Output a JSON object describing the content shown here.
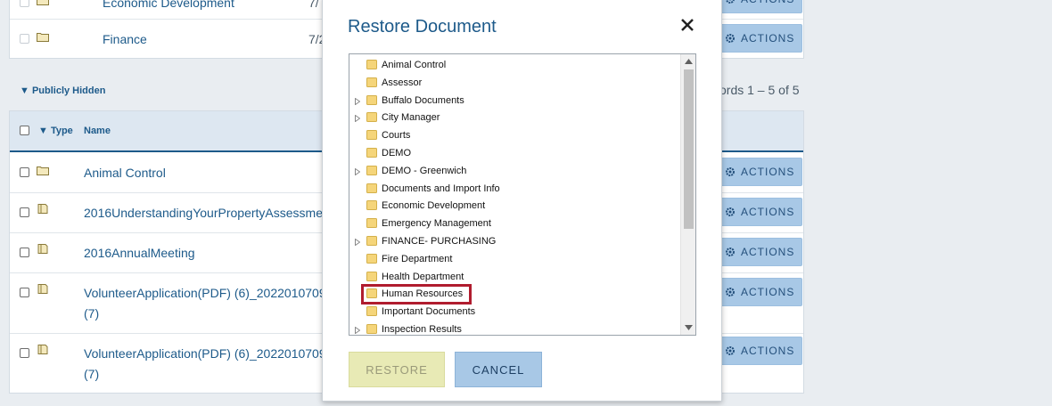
{
  "top_list": {
    "rows": [
      {
        "name": "Economic Development",
        "date": "7/"
      },
      {
        "name": "Finance",
        "date": "7/2"
      }
    ],
    "actions_label": "ACTIONS"
  },
  "hidden_section": {
    "title": "▼ Publicly Hidden",
    "records": "ords 1 – 5 of 5",
    "header": {
      "type": "▼ Type",
      "name": "Name"
    },
    "rows": [
      {
        "name": "Animal Control",
        "kind": "folder"
      },
      {
        "name": "2016UnderstandingYourPropertyAssessme",
        "kind": "doc"
      },
      {
        "name": "2016AnnualMeeting",
        "kind": "doc"
      },
      {
        "name": "VolunteerApplication(PDF) (6)_2022010709",
        "line2": "(7)",
        "kind": "doc"
      },
      {
        "name": "VolunteerApplication(PDF) (6)_2022010709",
        "line2": "(7)",
        "kind": "doc"
      }
    ],
    "actions_label": "ACTIONS"
  },
  "dialog": {
    "title": "Restore Document",
    "tree": [
      {
        "label": "Animal Control",
        "expandable": false
      },
      {
        "label": "Assessor",
        "expandable": false
      },
      {
        "label": "Buffalo Documents",
        "expandable": true
      },
      {
        "label": "City Manager",
        "expandable": true
      },
      {
        "label": "Courts",
        "expandable": false
      },
      {
        "label": "DEMO",
        "expandable": false
      },
      {
        "label": "DEMO - Greenwich",
        "expandable": true
      },
      {
        "label": "Documents and Import Info",
        "expandable": false
      },
      {
        "label": "Economic Development",
        "expandable": false
      },
      {
        "label": "Emergency Management",
        "expandable": false
      },
      {
        "label": "FINANCE- PURCHASING",
        "expandable": true
      },
      {
        "label": "Fire Department",
        "expandable": false
      },
      {
        "label": "Health Department",
        "expandable": false
      },
      {
        "label": "Human Resources",
        "expandable": false,
        "highlighted": true
      },
      {
        "label": "Important Documents",
        "expandable": false
      },
      {
        "label": "Inspection Results",
        "expandable": true
      }
    ],
    "restore_label": "RESTORE",
    "cancel_label": "CANCEL"
  },
  "colors": {
    "accent": "#1d5a8a",
    "actions_bg": "#a8c8e6",
    "highlight_border": "#b01c2e",
    "restore_disabled_bg": "#e8eab5",
    "folder_yellow": "#f5d57a"
  }
}
